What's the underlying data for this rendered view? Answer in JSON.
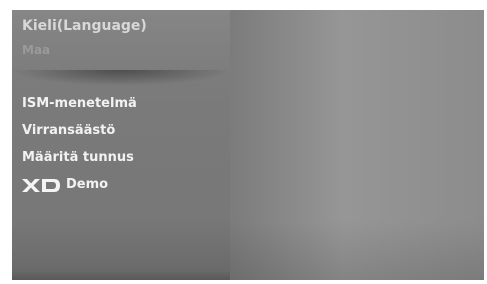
{
  "menu": {
    "language_label": "Kieli(Language)",
    "dimmed_label": "Maa",
    "items": [
      {
        "label": "ISM-menetelmä"
      },
      {
        "label": "Virransäästö"
      },
      {
        "label": "Määritä tunnus"
      },
      {
        "label": "Demo",
        "icon": "xd-logo-icon"
      }
    ]
  }
}
